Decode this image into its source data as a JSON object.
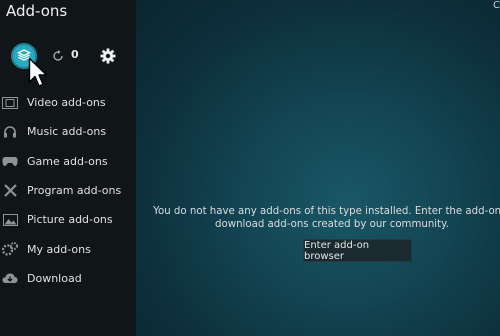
{
  "header": {
    "title": "Add-ons",
    "corner_mark": "C"
  },
  "toolbar": {
    "update_count": "0",
    "box_icon": "open-box-icon",
    "refresh_icon": "refresh-icon",
    "settings_icon": "gear-icon"
  },
  "sidebar": {
    "items": [
      {
        "label": "Video add-ons",
        "icon": "film-icon"
      },
      {
        "label": "Music add-ons",
        "icon": "headphones-icon"
      },
      {
        "label": "Game add-ons",
        "icon": "gamepad-icon"
      },
      {
        "label": "Program add-ons",
        "icon": "tools-icon"
      },
      {
        "label": "Picture add-ons",
        "icon": "picture-icon"
      },
      {
        "label": "My add-ons",
        "icon": "gears-icon"
      },
      {
        "label": "Download",
        "icon": "cloud-download-icon"
      }
    ]
  },
  "main": {
    "message_line1": "You do not have any add-ons of this type installed. Enter the add-on b",
    "message_line2": "download add-ons created by our community.",
    "browse_button": "Enter add-on browser"
  },
  "colors": {
    "accent": "#2aa9c2",
    "sidebar_bg": "#101517",
    "main_bg": "#134553"
  }
}
